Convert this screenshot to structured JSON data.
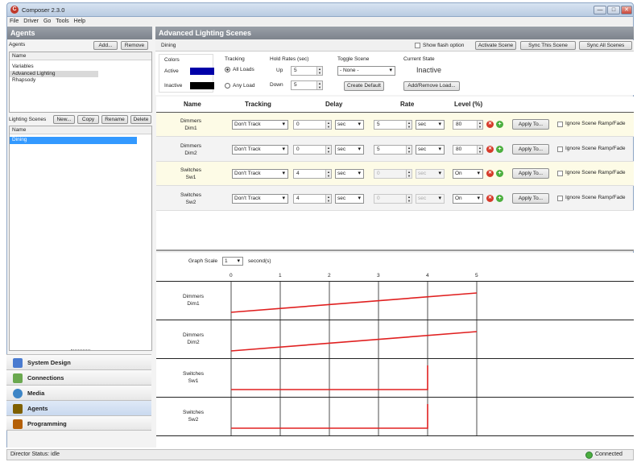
{
  "window": {
    "title": "Composer 2.3.0",
    "minimize": "—",
    "maximize": "□",
    "close": "✕"
  },
  "menu": [
    "File",
    "Driver",
    "Go",
    "Tools",
    "Help"
  ],
  "agents_panel": {
    "title": "Agents",
    "label": "Agents",
    "add": "Add...",
    "remove": "Remove",
    "list_header": "Name",
    "items": [
      "Variables",
      "Advanced Lighting",
      "Rhapsody"
    ]
  },
  "scenes_panel": {
    "label": "Lighting Scenes",
    "new": "New...",
    "copy": "Copy",
    "rename": "Rename",
    "delete": "Delete",
    "list_header": "Name",
    "items": [
      "Dining"
    ]
  },
  "nav": [
    "System Design",
    "Connections",
    "Media",
    "Agents",
    "Programming"
  ],
  "status": {
    "left": "Director Status: idle",
    "right": "Connected"
  },
  "main": {
    "title": "Advanced Lighting Scenes",
    "scene_name": "Dining",
    "show_flash": "Show flash option",
    "activate": "Activate Scene",
    "sync_this": "Sync This Scene",
    "sync_all": "Sync All Scenes"
  },
  "settings": {
    "colors_label": "Colors",
    "active_label": "Active",
    "inactive_label": "Inactive",
    "active_color": "#0000a8",
    "inactive_color": "#000000",
    "tracking_label": "Tracking",
    "all_loads": "All Loads",
    "any_load": "Any Load",
    "hold_label": "Hold Rates (sec)",
    "up_label": "Up",
    "up_value": "5",
    "down_label": "Down",
    "down_value": "5",
    "toggle_label": "Toggle Scene",
    "toggle_value": "- None -",
    "create_default": "Create Default",
    "state_label": "Current State",
    "state_value": "Inactive",
    "add_remove": "Add/Remove Load..."
  },
  "table": {
    "headers": [
      "Name",
      "Tracking",
      "Delay",
      "Rate",
      "Level (%)"
    ],
    "rows": [
      {
        "name1": "Dimmers",
        "name2": "Dim1",
        "tracking": "Don't Track",
        "delay": "0",
        "delay_unit": "sec",
        "rate": "5",
        "rate_unit": "sec",
        "level": "80",
        "apply": "Apply To...",
        "ignore": "Ignore Scene Ramp/Fade"
      },
      {
        "name1": "Dimmers",
        "name2": "Dim2",
        "tracking": "Don't Track",
        "delay": "0",
        "delay_unit": "sec",
        "rate": "5",
        "rate_unit": "sec",
        "level": "80",
        "apply": "Apply To...",
        "ignore": "Ignore Scene Ramp/Fade"
      },
      {
        "name1": "Switches",
        "name2": "Sw1",
        "tracking": "Don't Track",
        "delay": "4",
        "delay_unit": "sec",
        "rate": "0",
        "rate_unit": "sec",
        "level": "On",
        "apply": "Apply To...",
        "ignore": "Ignore Scene Ramp/Fade"
      },
      {
        "name1": "Switches",
        "name2": "Sw2",
        "tracking": "Don't Track",
        "delay": "4",
        "delay_unit": "sec",
        "rate": "0",
        "rate_unit": "sec",
        "level": "On",
        "apply": "Apply To...",
        "ignore": "Ignore Scene Ramp/Fade"
      }
    ]
  },
  "graph": {
    "scale_label": "Graph Scale",
    "scale_value": "1",
    "scale_unit": "second(s)",
    "ticks": [
      "0",
      "1",
      "2",
      "3",
      "4",
      "5"
    ],
    "rows": [
      {
        "name1": "Dimmers",
        "name2": "Dim1",
        "type": "ramp",
        "delay": 0,
        "rate": 5
      },
      {
        "name1": "Dimmers",
        "name2": "Dim2",
        "type": "ramp",
        "delay": 0,
        "rate": 5
      },
      {
        "name1": "Switches",
        "name2": "Sw1",
        "type": "step",
        "delay": 4
      },
      {
        "name1": "Switches",
        "name2": "Sw2",
        "type": "step",
        "delay": 4
      }
    ],
    "line_color": "#e02020"
  }
}
